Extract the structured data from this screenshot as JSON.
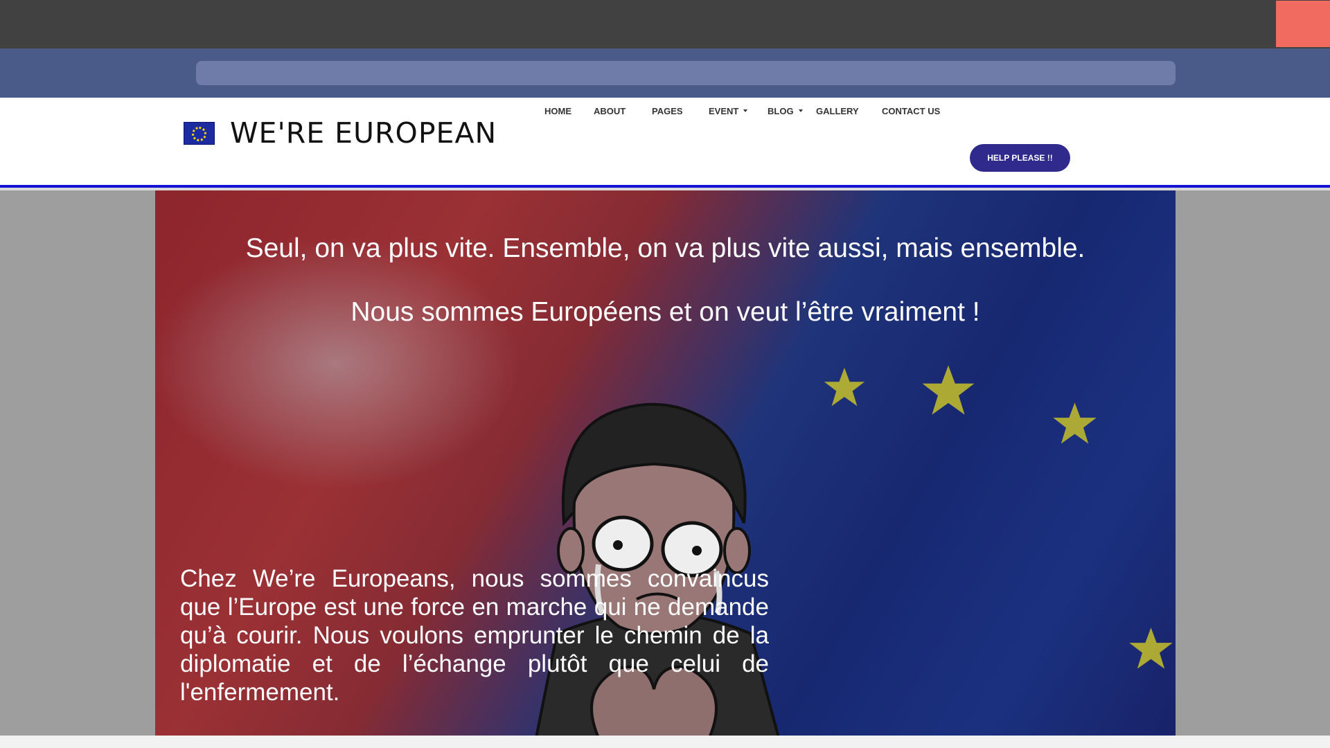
{
  "address_bar": {
    "value": ""
  },
  "site": {
    "logo_text": "WE'RE EUROPEAN",
    "nav": [
      {
        "label": "HOME",
        "dropdown": false
      },
      {
        "label": "ABOUT",
        "dropdown": false
      },
      {
        "label": "PAGES",
        "dropdown": false
      },
      {
        "label": "EVENT",
        "dropdown": true
      },
      {
        "label": "BLOG",
        "dropdown": true
      },
      {
        "label": "GALLERY",
        "dropdown": false
      },
      {
        "label": "CONTACT US",
        "dropdown": false
      }
    ],
    "help_button": "HELP PLEASE !!"
  },
  "hero": {
    "line1": "Seul, on va plus vite. Ensemble, on va plus vite aussi, mais ensemble.",
    "line2": "Nous sommes Européens et on veut l’être vraiment !",
    "paragraph": "Chez We’re Europeans, nous sommes convaincus que l’Europe est une force en marche qui ne demande qu’à courir. Nous voulons emprunter le chemin de la diplomatie et de l’échange plutôt que celui de l'enfermement."
  },
  "colors": {
    "accent_blue": "#1313d3",
    "help_button": "#2f2a8c",
    "close_button": "#f26b60"
  },
  "icons": [
    "eu-flag-icon",
    "close-icon",
    "caret-down-icon"
  ]
}
